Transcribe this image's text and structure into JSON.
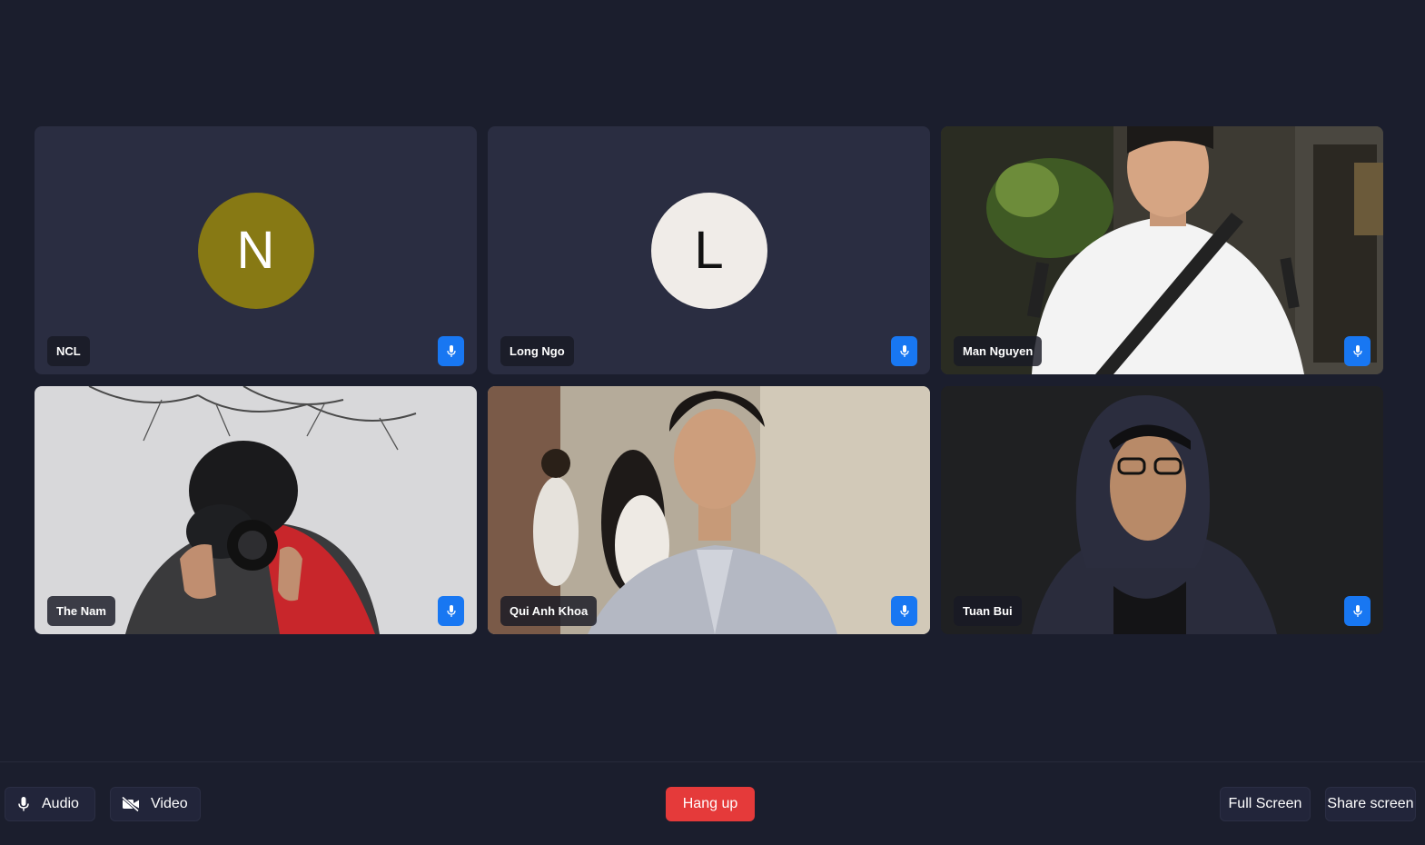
{
  "participants": [
    {
      "name": "NCL",
      "initial": "N",
      "avatar_color": "#877914",
      "initial_color": "#ffffff"
    },
    {
      "name": "Long Ngo",
      "initial": "L",
      "avatar_color": "#f0ece8",
      "initial_color": "#111111"
    },
    {
      "name": "Man Nguyen",
      "photo": "man-nguyen-video"
    },
    {
      "name": "The Nam",
      "photo": "the-nam-video"
    },
    {
      "name": "Qui Anh Khoa",
      "photo": "qui-anh-khoa-video"
    },
    {
      "name": "Tuan Bui",
      "photo": "tuan-bui-video"
    }
  ],
  "toolbar": {
    "audio_label": "Audio",
    "video_label": "Video",
    "hangup_label": "Hang up",
    "fullscreen_label": "Full Screen",
    "share_label": "Share screen"
  },
  "icons": {
    "mic": "microphone-icon",
    "video": "video-off-icon"
  },
  "colors": {
    "background": "#1b1e2d",
    "tile": "#2a2d41",
    "mic_button": "#1877f2",
    "hangup": "#e53a3a"
  }
}
